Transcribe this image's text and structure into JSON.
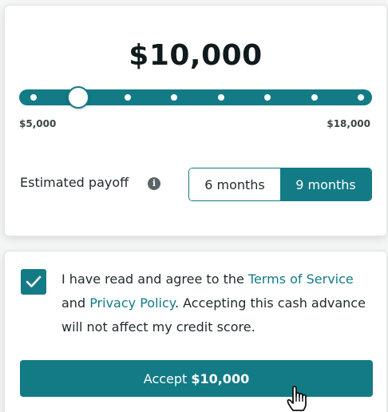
{
  "amount": {
    "display": "$10,000"
  },
  "slider": {
    "min_label": "$5,000",
    "max_label": "$18,000",
    "min": 5000,
    "max": 18000,
    "value": 10000,
    "steps": 9
  },
  "payoff": {
    "label": "Estimated payoff",
    "info_icon": "info-icon",
    "options": [
      {
        "label": "6 months",
        "selected": false
      },
      {
        "label": "9 months",
        "selected": true
      }
    ]
  },
  "agreement": {
    "checked": true,
    "text_1": "I have read and agree to the ",
    "terms_link": "Terms of Service",
    "text_2": " and ",
    "privacy_link": "Privacy Policy",
    "text_3": ". Accepting this cash advance will not affect my credit score."
  },
  "accept": {
    "prefix": "Accept",
    "amount": "$10,000"
  },
  "colors": {
    "accent": "#137b86",
    "text": "#1f2a2c",
    "background": "#f4f5f5"
  }
}
